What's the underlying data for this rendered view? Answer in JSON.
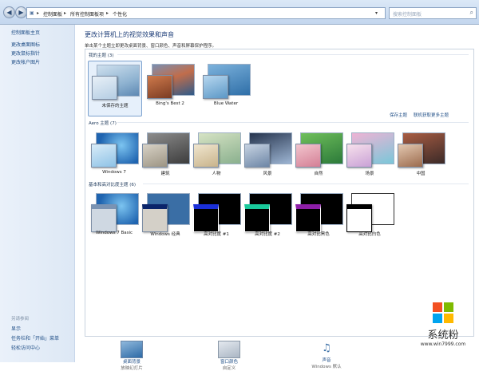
{
  "address": {
    "crumbs": [
      "控制面板",
      "所有控制面板项",
      "个性化"
    ],
    "separator": "▸"
  },
  "search": {
    "placeholder": "搜索控制面板"
  },
  "sidebar": {
    "links": [
      "控制面板主页",
      "更改桌面图标",
      "更改鼠标指针",
      "更改帐户图片"
    ],
    "see_also": {
      "heading": "另请参阅",
      "links": [
        "显示",
        "任务栏和「开始」菜单",
        "轻松访问中心"
      ]
    }
  },
  "main": {
    "title": "更改计算机上的视觉效果和声音",
    "subtitle": "单击某个主题立即更改桌面背景、窗口颜色、声音和屏幕保护程序。"
  },
  "my_themes": {
    "heading": "我的主题 (3)",
    "items": [
      "未保存的主题",
      "Bing's Best 2",
      "Blue Water"
    ],
    "save_link": "保存主题",
    "online_link": "联机获取更多主题"
  },
  "aero": {
    "heading": "Aero 主题 (7)",
    "items": [
      "Windows 7",
      "建筑",
      "人物",
      "风景",
      "自然",
      "场景",
      "中国"
    ]
  },
  "basic": {
    "heading": "基本和高对比度主题 (6)",
    "items": [
      "Windows 7 Basic",
      "Windows 经典",
      "高对比度 #1",
      "高对比度 #2",
      "高对比黑色",
      "高对比白色"
    ]
  },
  "bottom": [
    {
      "label": "桌面背景",
      "value": "放映幻灯片",
      "icon": "desktop-background-icon"
    },
    {
      "label": "窗口颜色",
      "value": "自定义",
      "icon": "window-color-icon"
    },
    {
      "label": "声音",
      "value": "Windows 默认",
      "icon": "sounds-icon"
    }
  ],
  "watermark": {
    "brand": "系统粉",
    "url": "www.win7999.com"
  },
  "colors": {
    "link": "#1f4e86",
    "title": "#1e3e78",
    "selection": "#e6f0fb"
  }
}
